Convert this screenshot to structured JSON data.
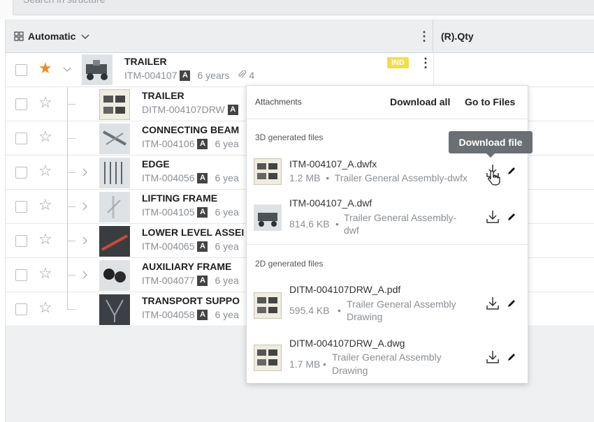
{
  "search": {
    "placeholder": "Search in structure"
  },
  "header": {
    "view_label": "Automatic",
    "qty_column": "(R).Qty"
  },
  "rows": [
    {
      "title": "TRAILER",
      "item": "ITM-004107",
      "rev": "A",
      "age": "6 years",
      "attachments": "4",
      "badge": "IND",
      "starred": true
    },
    {
      "title": "TRAILER",
      "item": "DITM-004107DRW",
      "rev": "A"
    },
    {
      "title": "CONNECTING BEAM",
      "item": "ITM-004106",
      "rev": "A",
      "age": "6 yea"
    },
    {
      "title": "EDGE",
      "item": "ITM-004056",
      "rev": "A",
      "age": "6 yea"
    },
    {
      "title": "LIFTING FRAME",
      "item": "ITM-004105",
      "rev": "A",
      "age": "6 yea"
    },
    {
      "title": "LOWER LEVEL ASSEI",
      "item": "ITM-004065",
      "rev": "A",
      "age": "6 yea"
    },
    {
      "title": "AUXILIARY FRAME",
      "item": "ITM-004077",
      "rev": "A",
      "age": "6 yea"
    },
    {
      "title": "TRANSPORT SUPPO",
      "item": "ITM-004058",
      "rev": "A",
      "age": "6 yea"
    }
  ],
  "popup": {
    "title": "Attachments",
    "download_all": "Download all",
    "go_to_files": "Go to Files",
    "section_3d": "3D generated files",
    "section_2d": "2D generated files",
    "files_3d": [
      {
        "name": "ITM-004107_A.dwfx",
        "size": "1.2 MB",
        "desc": "Trailer General Assembly-dwfx"
      },
      {
        "name": "ITM-004107_A.dwf",
        "size": "814.6 KB",
        "desc_line1": "Trailer General Assembly-",
        "desc_line2": "dwf"
      }
    ],
    "files_2d": [
      {
        "name": "DITM-004107DRW_A.pdf",
        "size": "595.4 KB",
        "desc_line1": "Trailer General Assembly",
        "desc_line2": "Drawing"
      },
      {
        "name": "DITM-004107DRW_A.dwg",
        "size": "1.7 MB",
        "desc_line1": "Trailer General Assembly",
        "desc_line2": "Drawing"
      }
    ],
    "separator": "•"
  },
  "tooltip": {
    "text": "Download file"
  },
  "colors": {
    "accent_star": "#f0891f",
    "badge": "#f3dd45",
    "tooltip_bg": "#6b6f73"
  }
}
